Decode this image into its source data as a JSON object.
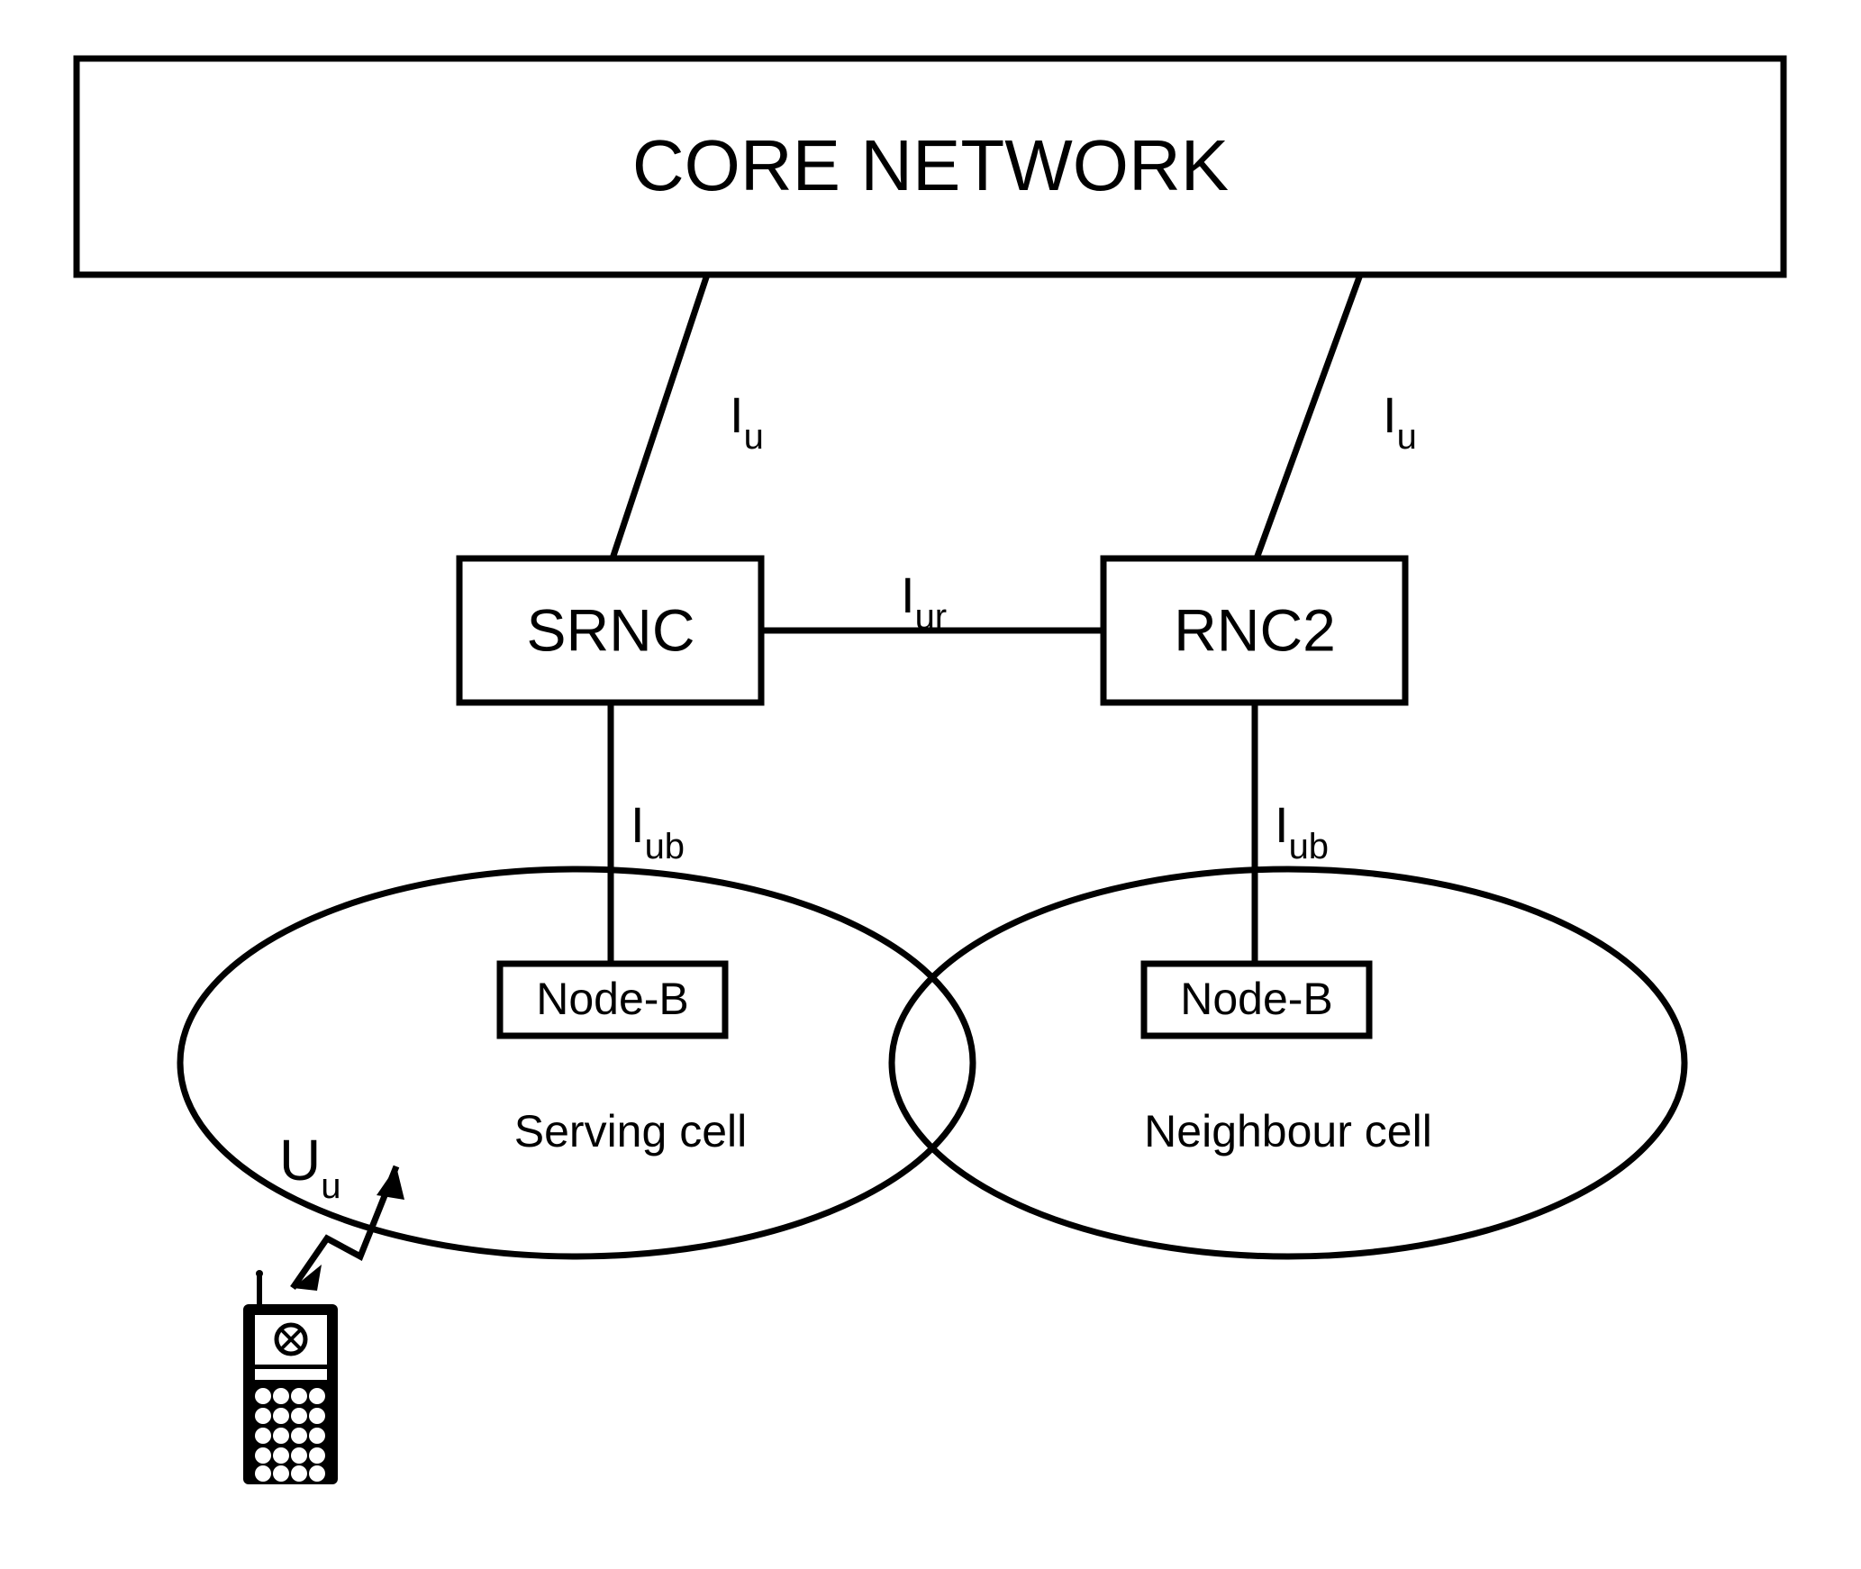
{
  "core_network": {
    "label": "CORE NETWORK"
  },
  "rnc": {
    "srnc": "SRNC",
    "rnc2": "RNC2"
  },
  "interfaces": {
    "iu_left": "I",
    "iu_left_sub": "u",
    "iu_right": "I",
    "iu_right_sub": "u",
    "iur": "I",
    "iur_sub": "ur",
    "iub_left": "I",
    "iub_left_sub": "ub",
    "iub_right": "I",
    "iub_right_sub": "ub",
    "uu": "U",
    "uu_sub": "u"
  },
  "nodes": {
    "nodeb_left": "Node-B",
    "nodeb_right": "Node-B"
  },
  "cells": {
    "serving": "Serving cell",
    "neighbour": "Neighbour cell"
  }
}
